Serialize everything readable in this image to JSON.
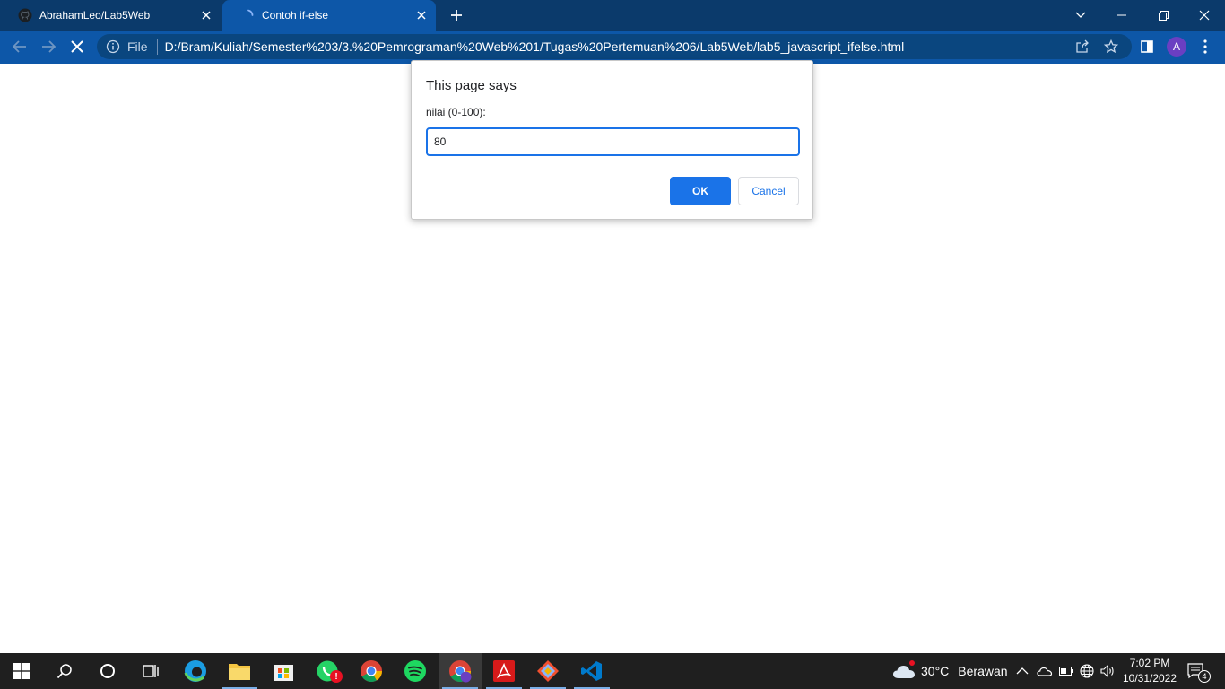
{
  "tabs": [
    {
      "title": "AbrahamLeo/Lab5Web",
      "icon": "github-icon"
    },
    {
      "title": "Contoh if-else",
      "icon": "loading-spinner-icon"
    }
  ],
  "toolbar": {
    "scheme_label": "File",
    "url": "D:/Bram/Kuliah/Semester%203/3.%20Pemrograman%20Web%201/Tugas%20Pertemuan%206/Lab5Web/lab5_javascript_ifelse.html",
    "profile_initial": "A"
  },
  "dialog": {
    "title": "This page says",
    "message": "nilai (0-100):",
    "input_value": "80",
    "ok_label": "OK",
    "cancel_label": "Cancel"
  },
  "taskbar": {
    "weather": "30°C",
    "weather_desc": "Berawan",
    "time": "7:02 PM",
    "date": "10/31/2022",
    "notification_count": "4",
    "whatsapp_badge": "!"
  },
  "colors": {
    "tabbar_bg": "#0b3a6b",
    "toolbar_bg": "#0d57a8",
    "accent": "#1a73e8",
    "taskbar_bg": "#1f1f1f"
  }
}
